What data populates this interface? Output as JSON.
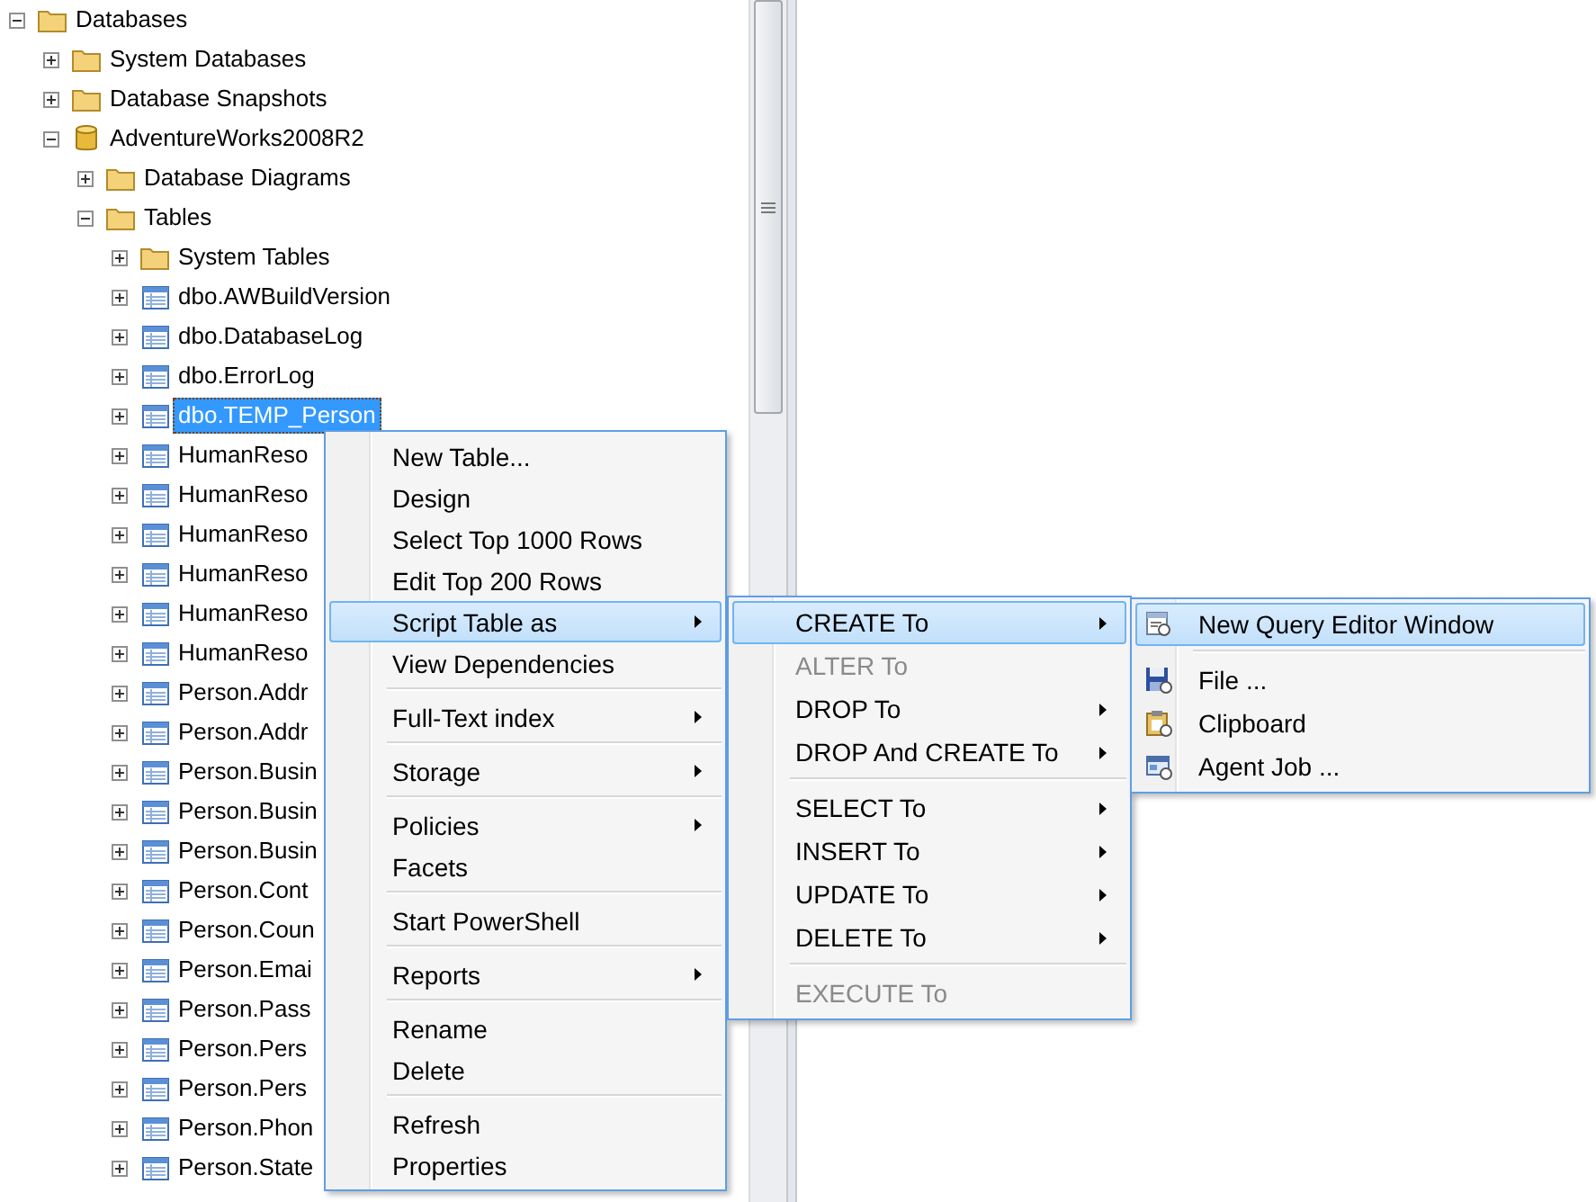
{
  "object_explorer": {
    "tree": [
      {
        "label": "Databases",
        "kind": "folder",
        "expanded": true,
        "selected": false,
        "children": [
          {
            "label": "System Databases",
            "kind": "folder",
            "expanded": false,
            "selected": false
          },
          {
            "label": "Database Snapshots",
            "kind": "folder",
            "expanded": false,
            "selected": false
          },
          {
            "label": "AdventureWorks2008R2",
            "kind": "database",
            "expanded": true,
            "selected": false,
            "children": [
              {
                "label": "Database Diagrams",
                "kind": "folder",
                "expanded": false,
                "selected": false
              },
              {
                "label": "Tables",
                "kind": "folder",
                "expanded": true,
                "selected": false,
                "children": [
                  {
                    "label": "System Tables",
                    "kind": "folder",
                    "expanded": false,
                    "selected": false
                  },
                  {
                    "label": "dbo.AWBuildVersion",
                    "kind": "table",
                    "expanded": false,
                    "selected": false
                  },
                  {
                    "label": "dbo.DatabaseLog",
                    "kind": "table",
                    "expanded": false,
                    "selected": false
                  },
                  {
                    "label": "dbo.ErrorLog",
                    "kind": "table",
                    "expanded": false,
                    "selected": false
                  },
                  {
                    "label": "dbo.TEMP_Person",
                    "kind": "table",
                    "expanded": false,
                    "selected": true
                  },
                  {
                    "label": "HumanReso",
                    "kind": "table",
                    "expanded": false,
                    "selected": false
                  },
                  {
                    "label": "HumanReso",
                    "kind": "table",
                    "expanded": false,
                    "selected": false
                  },
                  {
                    "label": "HumanReso",
                    "kind": "table",
                    "expanded": false,
                    "selected": false
                  },
                  {
                    "label": "HumanReso",
                    "kind": "table",
                    "expanded": false,
                    "selected": false
                  },
                  {
                    "label": "HumanReso",
                    "kind": "table",
                    "expanded": false,
                    "selected": false
                  },
                  {
                    "label": "HumanReso",
                    "kind": "table",
                    "expanded": false,
                    "selected": false
                  },
                  {
                    "label": "Person.Addr",
                    "kind": "table",
                    "expanded": false,
                    "selected": false
                  },
                  {
                    "label": "Person.Addr",
                    "kind": "table",
                    "expanded": false,
                    "selected": false
                  },
                  {
                    "label": "Person.Busin",
                    "kind": "table",
                    "expanded": false,
                    "selected": false
                  },
                  {
                    "label": "Person.Busin",
                    "kind": "table",
                    "expanded": false,
                    "selected": false
                  },
                  {
                    "label": "Person.Busin",
                    "kind": "table",
                    "expanded": false,
                    "selected": false
                  },
                  {
                    "label": "Person.Cont",
                    "kind": "table",
                    "expanded": false,
                    "selected": false
                  },
                  {
                    "label": "Person.Coun",
                    "kind": "table",
                    "expanded": false,
                    "selected": false
                  },
                  {
                    "label": "Person.Emai",
                    "kind": "table",
                    "expanded": false,
                    "selected": false
                  },
                  {
                    "label": "Person.Pass",
                    "kind": "table",
                    "expanded": false,
                    "selected": false
                  },
                  {
                    "label": "Person.Pers",
                    "kind": "table",
                    "expanded": false,
                    "selected": false
                  },
                  {
                    "label": "Person.Pers",
                    "kind": "table",
                    "expanded": false,
                    "selected": false
                  },
                  {
                    "label": "Person.Phon",
                    "kind": "table",
                    "expanded": false,
                    "selected": false
                  },
                  {
                    "label": "Person.State",
                    "kind": "table",
                    "expanded": false,
                    "selected": false
                  }
                ]
              }
            ]
          }
        ]
      }
    ]
  },
  "context_menu": {
    "groups": [
      {
        "items": [
          {
            "label": "New Table...",
            "submenu": false,
            "disabled": false,
            "selected": false
          },
          {
            "label": "Design",
            "submenu": false,
            "disabled": false,
            "selected": false
          },
          {
            "label": "Select Top 1000 Rows",
            "submenu": false,
            "disabled": false,
            "selected": false
          },
          {
            "label": "Edit Top 200 Rows",
            "submenu": false,
            "disabled": false,
            "selected": false
          },
          {
            "label": "Script Table as",
            "submenu": true,
            "disabled": false,
            "selected": true
          },
          {
            "label": "View Dependencies",
            "submenu": false,
            "disabled": false,
            "selected": false
          }
        ]
      },
      {
        "items": [
          {
            "label": "Full-Text index",
            "submenu": true,
            "disabled": false,
            "selected": false
          }
        ]
      },
      {
        "items": [
          {
            "label": "Storage",
            "submenu": true,
            "disabled": false,
            "selected": false
          }
        ]
      },
      {
        "items": [
          {
            "label": "Policies",
            "submenu": true,
            "disabled": false,
            "selected": false
          },
          {
            "label": "Facets",
            "submenu": false,
            "disabled": false,
            "selected": false
          }
        ]
      },
      {
        "items": [
          {
            "label": "Start PowerShell",
            "submenu": false,
            "disabled": false,
            "selected": false
          }
        ]
      },
      {
        "items": [
          {
            "label": "Reports",
            "submenu": true,
            "disabled": false,
            "selected": false
          }
        ]
      },
      {
        "items": [
          {
            "label": "Rename",
            "submenu": false,
            "disabled": false,
            "selected": false
          },
          {
            "label": "Delete",
            "submenu": false,
            "disabled": false,
            "selected": false
          }
        ]
      },
      {
        "items": [
          {
            "label": "Refresh",
            "submenu": false,
            "disabled": false,
            "selected": false
          },
          {
            "label": "Properties",
            "submenu": false,
            "disabled": false,
            "selected": false
          }
        ]
      }
    ]
  },
  "script_submenu": {
    "groups": [
      {
        "items": [
          {
            "label": "CREATE To",
            "submenu": true,
            "disabled": false,
            "selected": true
          },
          {
            "label": "ALTER To",
            "submenu": false,
            "disabled": true,
            "selected": false
          },
          {
            "label": "DROP To",
            "submenu": true,
            "disabled": false,
            "selected": false
          },
          {
            "label": "DROP And CREATE To",
            "submenu": true,
            "disabled": false,
            "selected": false
          }
        ]
      },
      {
        "items": [
          {
            "label": "SELECT To",
            "submenu": true,
            "disabled": false,
            "selected": false
          },
          {
            "label": "INSERT To",
            "submenu": true,
            "disabled": false,
            "selected": false
          },
          {
            "label": "UPDATE To",
            "submenu": true,
            "disabled": false,
            "selected": false
          },
          {
            "label": "DELETE To",
            "submenu": true,
            "disabled": false,
            "selected": false
          }
        ]
      },
      {
        "items": [
          {
            "label": "EXECUTE To",
            "submenu": false,
            "disabled": true,
            "selected": false
          }
        ]
      }
    ]
  },
  "create_submenu": {
    "groups": [
      {
        "items": [
          {
            "label": "New Query Editor Window",
            "submenu": false,
            "disabled": false,
            "selected": true
          }
        ]
      },
      {
        "items": [
          {
            "label": "File ...",
            "submenu": false,
            "disabled": false,
            "selected": false
          },
          {
            "label": "Clipboard",
            "submenu": false,
            "disabled": false,
            "selected": false
          },
          {
            "label": "Agent Job ...",
            "submenu": false,
            "disabled": false,
            "selected": false
          }
        ]
      }
    ]
  }
}
